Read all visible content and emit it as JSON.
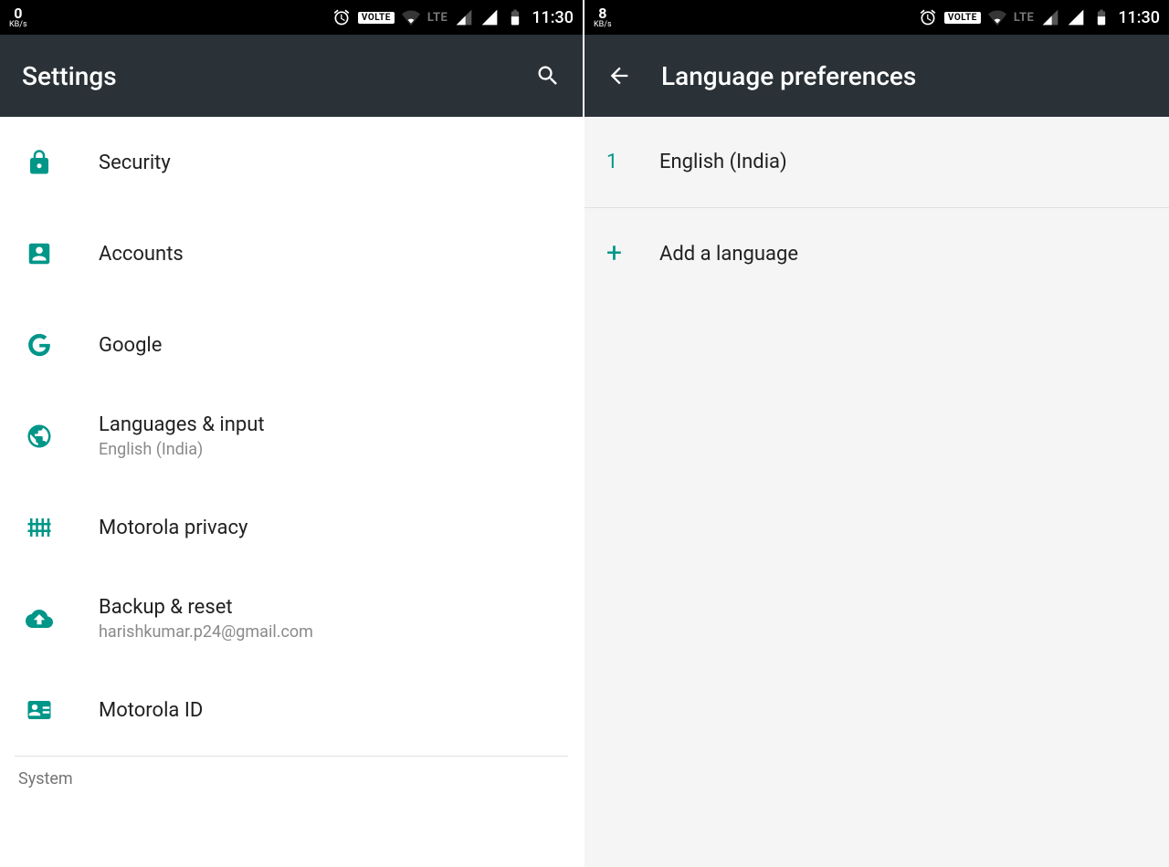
{
  "left": {
    "status": {
      "speed": "0",
      "speed_unit": "KB/s",
      "volte": "VOLTE",
      "lte": "LTE",
      "time": "11:30"
    },
    "appbar": {
      "title": "Settings"
    },
    "items": [
      {
        "icon": "lock-icon",
        "title": "Security",
        "sub": ""
      },
      {
        "icon": "account-icon",
        "title": "Accounts",
        "sub": ""
      },
      {
        "icon": "google-icon",
        "title": "Google",
        "sub": ""
      },
      {
        "icon": "globe-icon",
        "title": "Languages & input",
        "sub": "English (India)"
      },
      {
        "icon": "fence-icon",
        "title": "Motorola privacy",
        "sub": ""
      },
      {
        "icon": "cloud-upload-icon",
        "title": "Backup & reset",
        "sub": "harishkumar.p24@gmail.com"
      },
      {
        "icon": "id-card-icon",
        "title": "Motorola ID",
        "sub": ""
      }
    ],
    "section_header": "System"
  },
  "right": {
    "status": {
      "speed": "8",
      "speed_unit": "KB/s",
      "volte": "VOLTE",
      "lte": "LTE",
      "time": "11:30"
    },
    "appbar": {
      "title": "Language preferences"
    },
    "languages": [
      {
        "index": "1",
        "label": "English (India)"
      }
    ],
    "add_language_label": "Add a language"
  }
}
